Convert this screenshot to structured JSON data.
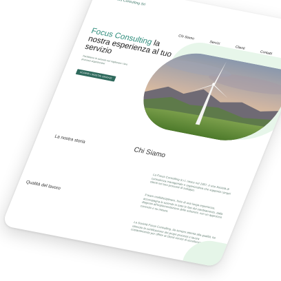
{
  "brand": {
    "name": "Focus Consulting Srl",
    "accent_color": "#2f8d7c",
    "button_color": "#2f6a5d",
    "light_green": "#e7f6ea"
  },
  "nav": {
    "items": [
      "Chi Siamo",
      "Servizi",
      "Clienti",
      "Contatti"
    ]
  },
  "hero": {
    "brand_word": "Focus Consulting",
    "title_rest": " la nostra esperienza al tuo servizio",
    "subtitle": "Facilitiamo le aziende nel migliorare i loro processi organizzativi",
    "cta_label": "SCOPRI I NOSTRI SERVIZI",
    "image_description_icon": "wind-turbine-landscape"
  },
  "about": {
    "section_title": "Chi Siamo",
    "label_story": "La nostra storia",
    "label_quality": "Qualità del lavoro",
    "paragraphs": [
      "La Focus Consulting S.r.l. nasce nel 1997, è una Società di consulenza manageriale e organizzativa che supporta i propri clienti nei loro processi di sviluppo.",
      "Il team multidisciplinare, forte di una lunga esperienza, accompagna le aziende in tutte le fasi del cambiamento, dalla diagnosi all'implementazione delle soluzioni, con un approccio concreto e su misura.",
      "La Società Focus Consulting, da sempre attenta alla qualità, ha ottenuto la certificazione dei propri processi e lavora costantemente per offrire ai clienti servizi di eccellenza."
    ]
  }
}
